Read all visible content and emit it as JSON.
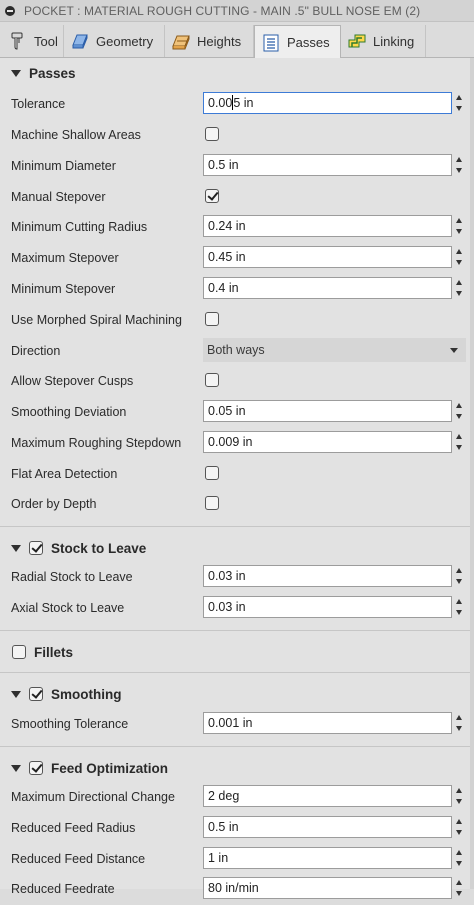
{
  "window": {
    "title": "POCKET : MATERIAL ROUGH CUTTING - MAIN .5\" BULL NOSE EM (2)"
  },
  "tabs": [
    {
      "label": "Tool",
      "icon": "tool-icon",
      "active": false
    },
    {
      "label": "Geometry",
      "icon": "geometry-icon",
      "active": false
    },
    {
      "label": "Heights",
      "icon": "heights-icon",
      "active": false
    },
    {
      "label": "Passes",
      "icon": "passes-icon",
      "active": true
    },
    {
      "label": "Linking",
      "icon": "linking-icon",
      "active": false
    }
  ],
  "passes": {
    "header": "Passes",
    "tolerance": {
      "label": "Tolerance",
      "value": "0.005 in",
      "before_caret": "0.00",
      "after_caret": "5 in"
    },
    "machine_shallow": {
      "label": "Machine Shallow Areas",
      "checked": false
    },
    "min_diameter": {
      "label": "Minimum Diameter",
      "value": "0.5 in"
    },
    "manual_stepover": {
      "label": "Manual Stepover",
      "checked": true
    },
    "min_cutting_radius": {
      "label": "Minimum Cutting Radius",
      "value": "0.24 in"
    },
    "max_stepover": {
      "label": "Maximum Stepover",
      "value": "0.45 in"
    },
    "min_stepover": {
      "label": "Minimum Stepover",
      "value": "0.4 in"
    },
    "morphed_spiral": {
      "label": "Use Morphed Spiral Machining",
      "checked": false
    },
    "direction": {
      "label": "Direction",
      "value": "Both ways"
    },
    "allow_cusps": {
      "label": "Allow Stepover Cusps",
      "checked": false
    },
    "smoothing_deviation": {
      "label": "Smoothing Deviation",
      "value": "0.05 in"
    },
    "max_roughing_stepdown": {
      "label": "Maximum Roughing Stepdown",
      "value": "0.009 in"
    },
    "flat_area": {
      "label": "Flat Area Detection",
      "checked": false
    },
    "order_by_depth": {
      "label": "Order by Depth",
      "checked": false
    }
  },
  "stock": {
    "header": "Stock to Leave",
    "enabled": true,
    "radial": {
      "label": "Radial Stock to Leave",
      "value": "0.03 in"
    },
    "axial": {
      "label": "Axial Stock to Leave",
      "value": "0.03 in"
    }
  },
  "fillets": {
    "header": "Fillets",
    "enabled": false
  },
  "smoothing": {
    "header": "Smoothing",
    "enabled": true,
    "tolerance": {
      "label": "Smoothing Tolerance",
      "value": "0.001 in"
    }
  },
  "feed": {
    "header": "Feed Optimization",
    "enabled": true,
    "max_dir_change": {
      "label": "Maximum Directional Change",
      "value": "2 deg"
    },
    "reduced_radius": {
      "label": "Reduced Feed Radius",
      "value": "0.5 in"
    },
    "reduced_distance": {
      "label": "Reduced Feed Distance",
      "value": "1 in"
    },
    "reduced_feedrate": {
      "label": "Reduced Feedrate",
      "value": "80 in/min"
    }
  }
}
